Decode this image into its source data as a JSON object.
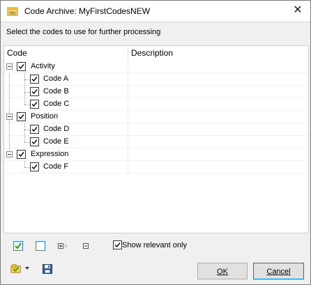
{
  "window": {
    "title": "Code Archive: MyFirstCodesNEW",
    "close_glyph": "✕"
  },
  "instruction": "Select the codes to use for further processing",
  "columns": {
    "code": "Code",
    "description": "Description"
  },
  "tree": [
    {
      "label": "Activity",
      "checked": true,
      "children": [
        {
          "label": "Code A",
          "checked": true
        },
        {
          "label": "Code B",
          "checked": true
        },
        {
          "label": "Code C",
          "checked": true
        }
      ]
    },
    {
      "label": "Position",
      "checked": true,
      "children": [
        {
          "label": "Code D",
          "checked": true
        },
        {
          "label": "Code E",
          "checked": true
        }
      ]
    },
    {
      "label": "Expression",
      "checked": true,
      "children": [
        {
          "label": "Code F",
          "checked": true
        }
      ]
    }
  ],
  "toolbar": {
    "icons": [
      "check-all-icon",
      "uncheck-all-icon",
      "expand-all-icon",
      "collapse-all-icon"
    ],
    "show_relevant_label": "Show relevant only",
    "show_relevant_checked": true
  },
  "footer": {
    "icons": [
      "code-archive-menu-icon",
      "dropdown-arrow-icon",
      "save-icon"
    ],
    "ok_label": "OK",
    "cancel_label": "Cancel"
  },
  "colors": {
    "accent": "#0078d7",
    "check_green": "#3a9a2a",
    "panel_border": "#cfcfcf"
  }
}
